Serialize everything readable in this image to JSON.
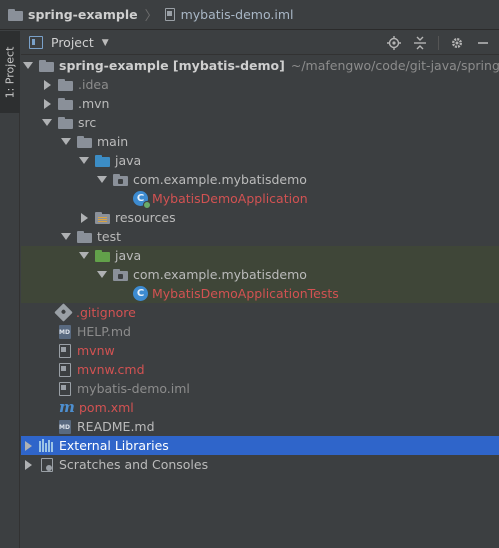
{
  "breadcrumb": {
    "project": "spring-example",
    "file": "mybatis-demo.iml"
  },
  "side_stripe": {
    "tab_label": "1: Project"
  },
  "panel": {
    "title": "Project",
    "tools": [
      "locate-icon",
      "collapse-icon",
      "gear-icon",
      "hide-icon"
    ]
  },
  "tree": {
    "root": {
      "label": "spring-example [mybatis-demo]",
      "path": "~/mafengwo/code/git-java/spring-e"
    },
    "idea": ".idea",
    "mvn": ".mvn",
    "src": "src",
    "main": "main",
    "main_java": "java",
    "main_pkg": "com.example.mybatisdemo",
    "main_class": "MybatisDemoApplication",
    "resources": "resources",
    "test": "test",
    "test_java": "java",
    "test_pkg": "com.example.mybatisdemo",
    "test_class": "MybatisDemoApplicationTests",
    "gitignore": ".gitignore",
    "help": "HELP.md",
    "mvnw": "mvnw",
    "mvnw_cmd": "mvnw.cmd",
    "iml": "mybatis-demo.iml",
    "pom": "pom.xml",
    "readme": "README.md",
    "ext_libs": "External Libraries",
    "scratches": "Scratches and Consoles"
  },
  "colors": {
    "background": "#3c3f41",
    "selection": "#2f65ca",
    "test_highlight": "#3f4638",
    "modified_red": "#d25252",
    "source_folder_blue": "#3c8dc5",
    "test_folder_green": "#62a14a"
  }
}
